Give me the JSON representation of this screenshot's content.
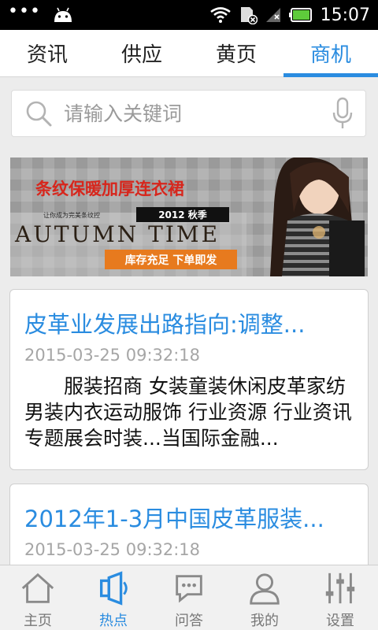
{
  "status_bar": {
    "time": "15:07",
    "battery_level": 1.0
  },
  "tabs": [
    {
      "label": "资讯",
      "active": false
    },
    {
      "label": "供应",
      "active": false
    },
    {
      "label": "黄页",
      "active": false
    },
    {
      "label": "商机",
      "active": true
    }
  ],
  "search": {
    "placeholder": "请输入关键词"
  },
  "banner": {
    "headline": "条纹保暖加厚连衣裙",
    "tagline": "让你成为完美条纹控",
    "season": "2012 秋季",
    "brand_text": "AUTUMN TIME",
    "cta": "库存充足  下单即发"
  },
  "articles": [
    {
      "title": "皮革业发展出路指向:调整...",
      "date": "2015-03-25 09:32:18",
      "summary": "服装招商 女装童装休闲皮革家纺男装内衣运动服饰 行业资源 行业资讯专题展会时装...当国际金融..."
    },
    {
      "title": "2012年1-3月中国皮革服装...",
      "date": "2015-03-25 09:32:18"
    }
  ],
  "bottom_nav": [
    {
      "label": "主页",
      "icon": "home-icon",
      "active": false
    },
    {
      "label": "热点",
      "icon": "hotspot-icon",
      "active": true
    },
    {
      "label": "问答",
      "icon": "chat-icon",
      "active": false
    },
    {
      "label": "我的",
      "icon": "user-icon",
      "active": false
    },
    {
      "label": "设置",
      "icon": "settings-icon",
      "active": false
    }
  ],
  "colors": {
    "accent": "#2a8ce0",
    "banner_red": "#d7261c",
    "banner_orange": "#e77a1e"
  }
}
